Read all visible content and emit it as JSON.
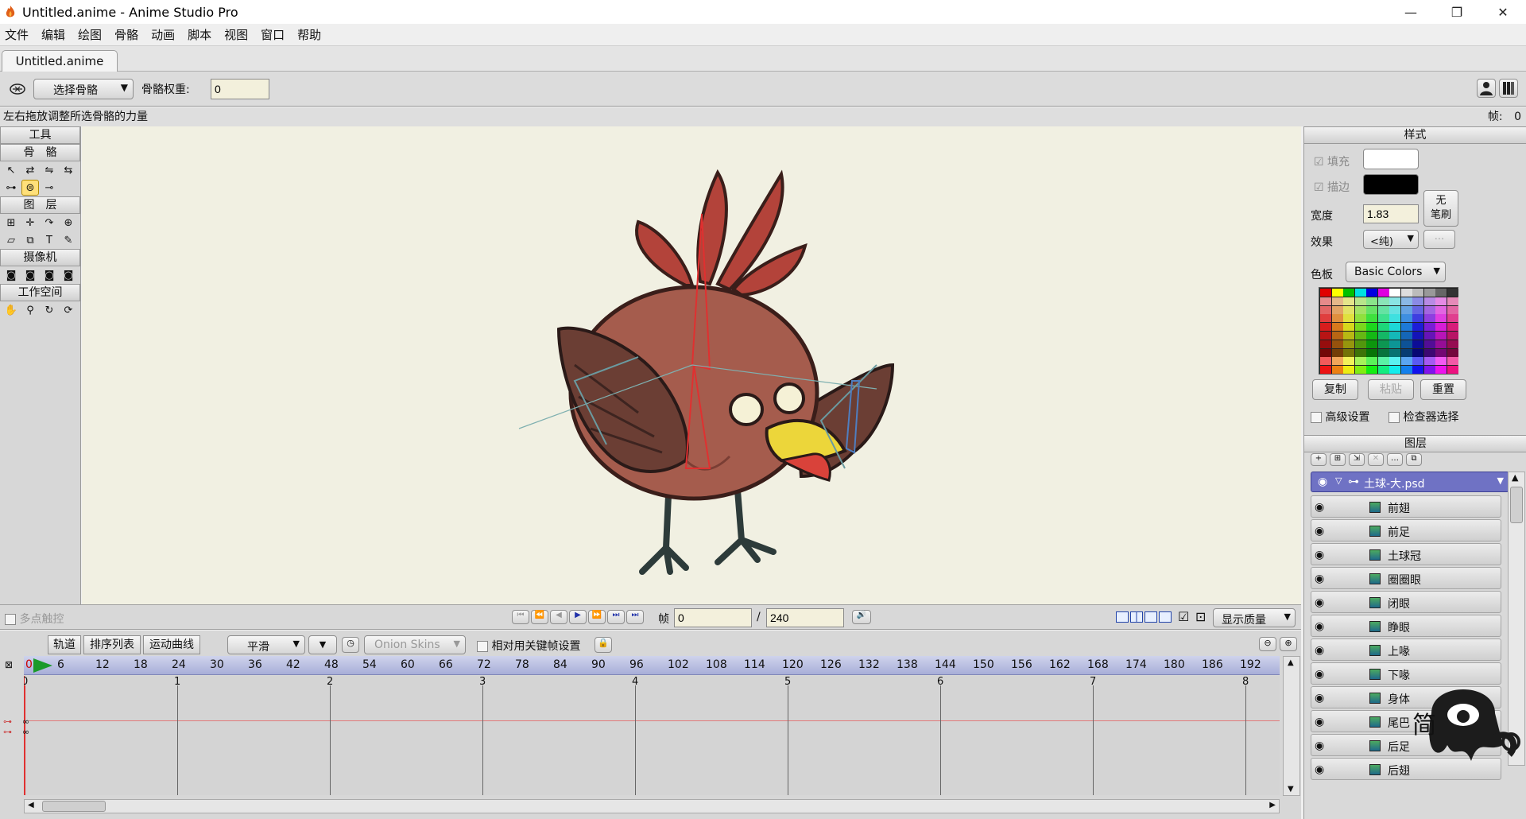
{
  "window": {
    "title": "Untitled.anime - Anime Studio Pro",
    "minimize_glyph": "—",
    "maximize_glyph": "❐",
    "close_glyph": "✕"
  },
  "menu": [
    "文件",
    "编辑",
    "绘图",
    "骨骼",
    "动画",
    "脚本",
    "视图",
    "窗口",
    "帮助"
  ],
  "doc_tab": "Untitled.anime",
  "toolopts": {
    "mode_select": "选择骨骼",
    "weight_label": "骨骼权重:",
    "weight_value": "0"
  },
  "status": {
    "hint": "左右拖放调整所选骨骼的力量",
    "frame_label": "帧:",
    "frame_value": "0"
  },
  "tools": {
    "title": "工具",
    "sections": {
      "bone": "骨　骼",
      "layer": "图　层",
      "camera": "摄像机",
      "workspace": "工作空间"
    }
  },
  "style_panel": {
    "title": "样式",
    "fill_label": "填充",
    "stroke_label": "描边",
    "no_brush": "无\n笔刷",
    "width_label": "宽度",
    "width_value": "1.83",
    "effect_label": "效果",
    "effect_value": "<纯)",
    "effect_more": "...",
    "palette_label": "色板",
    "palette_value": "Basic Colors",
    "copy_btn": "复制",
    "paste_btn": "粘贴",
    "reset_btn": "重置",
    "advanced_label": "高级设置",
    "inspector_label": "检查器选择",
    "fill_color": "#ffffff",
    "stroke_color": "#000000"
  },
  "layers_panel": {
    "title": "图层",
    "group": "土球-大.psd",
    "items": [
      "前翅",
      "前足",
      "土球冠",
      "圈圈眼",
      "闭眼",
      "睁眼",
      "上喙",
      "下喙",
      "身体",
      "尾巴",
      "后足",
      "后翅"
    ]
  },
  "playback": {
    "multitouch_label": "多点触控",
    "frame_label": "帧",
    "frame_value": "0",
    "separator": "/",
    "total_frames": "240",
    "quality_label": "显示质量"
  },
  "timeline": {
    "tabs": [
      "轨道",
      "排序列表",
      "运动曲线"
    ],
    "interp": "平滑",
    "onion": "Onion Skins",
    "relative_label": "相对用关键帧设置",
    "ruler_start": "0",
    "ruler": [
      "6",
      "12",
      "18",
      "24",
      "30",
      "36",
      "42",
      "48",
      "54",
      "60",
      "66",
      "72",
      "78",
      "84",
      "90",
      "96",
      "102",
      "108",
      "114",
      "120",
      "126",
      "132",
      "138",
      "144",
      "150",
      "156",
      "162",
      "168",
      "174",
      "180",
      "186",
      "192"
    ],
    "seconds": [
      "0",
      "1",
      "2",
      "3",
      "4",
      "5",
      "6",
      "7",
      "8"
    ]
  },
  "watermark": {
    "text": "简"
  }
}
